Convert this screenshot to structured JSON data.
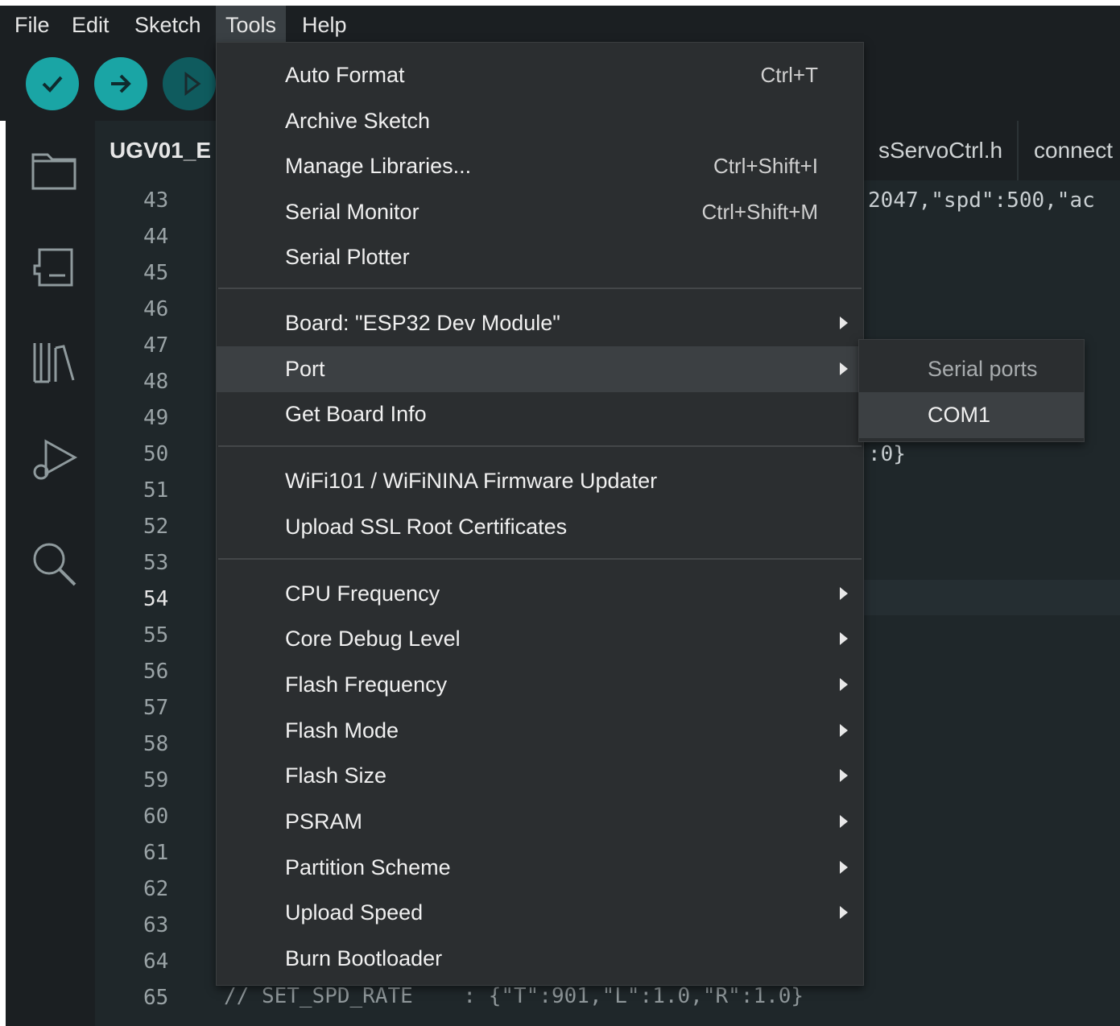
{
  "menubar": {
    "items": [
      "File",
      "Edit",
      "Sketch",
      "Tools",
      "Help"
    ],
    "active": "Tools"
  },
  "editor": {
    "tabs": [
      "UGV01_E",
      "sServoCtrl.h",
      "connect"
    ],
    "line_numbers": [
      "43",
      "44",
      "45",
      "46",
      "47",
      "48",
      "49",
      "50",
      "51",
      "52",
      "53",
      "54",
      "55",
      "56",
      "57",
      "58",
      "59",
      "60",
      "61",
      "62",
      "63",
      "64",
      "65"
    ],
    "current_line": "54",
    "code_fragments": {
      "line43": "2047,\"spd\":500,\"ac",
      "line50": ":0}",
      "line65": "// SET_SPD_RATE    : {\"T\":901,\"L\":1.0,\"R\":1.0}"
    }
  },
  "tools_menu": {
    "items": [
      {
        "label": "Auto Format",
        "shortcut": "Ctrl+T"
      },
      {
        "label": "Archive Sketch",
        "shortcut": ""
      },
      {
        "label": "Manage Libraries...",
        "shortcut": "Ctrl+Shift+I"
      },
      {
        "label": "Serial Monitor",
        "shortcut": "Ctrl+Shift+M"
      },
      {
        "label": "Serial Plotter",
        "shortcut": ""
      },
      {
        "label": "Board: \"ESP32 Dev Module\"",
        "shortcut": ""
      },
      {
        "label": "Port",
        "shortcut": ""
      },
      {
        "label": "Get Board Info",
        "shortcut": ""
      },
      {
        "label": "WiFi101 / WiFiNINA Firmware Updater",
        "shortcut": ""
      },
      {
        "label": "Upload SSL Root Certificates",
        "shortcut": ""
      },
      {
        "label": "CPU Frequency",
        "shortcut": ""
      },
      {
        "label": "Core Debug Level",
        "shortcut": ""
      },
      {
        "label": "Flash Frequency",
        "shortcut": ""
      },
      {
        "label": "Flash Mode",
        "shortcut": ""
      },
      {
        "label": "Flash Size",
        "shortcut": ""
      },
      {
        "label": "PSRAM",
        "shortcut": ""
      },
      {
        "label": "Partition Scheme",
        "shortcut": ""
      },
      {
        "label": "Upload Speed",
        "shortcut": ""
      },
      {
        "label": "Burn Bootloader",
        "shortcut": ""
      }
    ],
    "highlighted": "Port"
  },
  "port_submenu": {
    "header": "Serial ports",
    "items": [
      "COM1"
    ],
    "highlighted": "COM1"
  },
  "colors": {
    "accent": "#1aa5a5",
    "menu_bg": "#2b2e30",
    "menu_highlight": "#3c4043",
    "editor_bg": "#1f272a"
  }
}
